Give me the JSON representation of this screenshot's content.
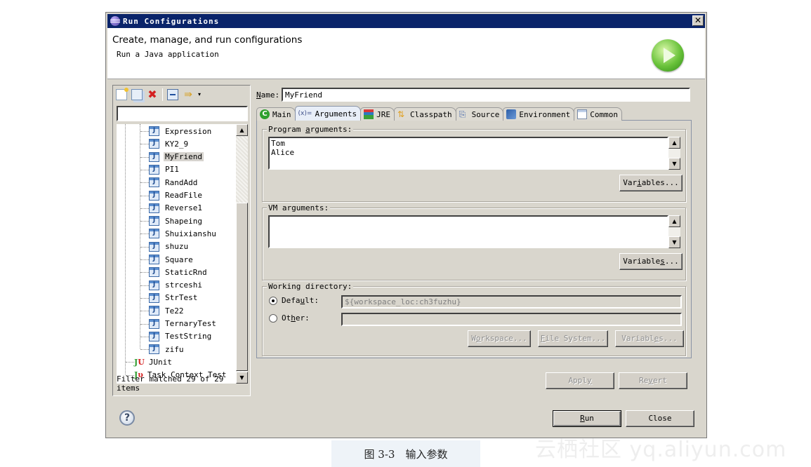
{
  "window": {
    "title": "Run Configurations",
    "close_glyph": "✕"
  },
  "header": {
    "title": "Create, manage, and run configurations",
    "subtitle": "Run a Java application",
    "icon": "run-icon"
  },
  "left": {
    "toolbar": [
      {
        "name": "new-configuration",
        "icon": "new-launch-config-icon"
      },
      {
        "name": "duplicate",
        "icon": "duplicate-icon"
      },
      {
        "name": "delete",
        "icon": "delete-icon",
        "glyph": "✖"
      },
      {
        "name": "collapse-all",
        "icon": "collapse-all-icon"
      },
      {
        "name": "filter",
        "icon": "filter-icon",
        "glyph": "⇛"
      },
      {
        "name": "view-menu",
        "icon": "dropdown-icon",
        "glyph": "▾"
      }
    ],
    "filter_value": "",
    "tree": [
      {
        "label": "Expression",
        "type": "java",
        "level": 2
      },
      {
        "label": "KY2_9",
        "type": "java",
        "level": 2
      },
      {
        "label": "MyFriend",
        "type": "java",
        "level": 2,
        "selected": true
      },
      {
        "label": "PI1",
        "type": "java",
        "level": 2
      },
      {
        "label": "RandAdd",
        "type": "java",
        "level": 2
      },
      {
        "label": "ReadFile",
        "type": "java",
        "level": 2
      },
      {
        "label": "Reverse1",
        "type": "java",
        "level": 2
      },
      {
        "label": "Shapeing",
        "type": "java",
        "level": 2
      },
      {
        "label": "Shuixianshu",
        "type": "java",
        "level": 2
      },
      {
        "label": "shuzu",
        "type": "java",
        "level": 2
      },
      {
        "label": "Square",
        "type": "java",
        "level": 2
      },
      {
        "label": "StaticRnd",
        "type": "java",
        "level": 2
      },
      {
        "label": "strceshi",
        "type": "java",
        "level": 2
      },
      {
        "label": "StrTest",
        "type": "java",
        "level": 2
      },
      {
        "label": "Te22",
        "type": "java",
        "level": 2
      },
      {
        "label": "TernaryTest",
        "type": "java",
        "level": 2
      },
      {
        "label": "TestString",
        "type": "java",
        "level": 2
      },
      {
        "label": "zifu",
        "type": "java",
        "level": 2
      },
      {
        "label": "JUnit",
        "type": "junit",
        "level": 1
      },
      {
        "label": "Task Context Test",
        "type": "junit-task",
        "level": 1
      }
    ],
    "status": "Filter matched 29 of 29 items"
  },
  "config": {
    "name_label": "Name:",
    "name_value": "MyFriend",
    "tabs": [
      {
        "label": "Main",
        "icon": "main-tab-icon",
        "glyph": "C"
      },
      {
        "label": "Arguments",
        "icon": "arguments-tab-icon",
        "glyph": "(x)=",
        "active": true
      },
      {
        "label": "JRE",
        "icon": "jre-tab-icon"
      },
      {
        "label": "Classpath",
        "icon": "classpath-tab-icon",
        "glyph": "⇅"
      },
      {
        "label": "Source",
        "icon": "source-tab-icon",
        "glyph": "⎘"
      },
      {
        "label": "Environment",
        "icon": "environment-tab-icon"
      },
      {
        "label": "Common",
        "icon": "common-tab-icon"
      }
    ],
    "program_args": {
      "label": "Program arguments:",
      "value": "Tom\nAlice",
      "variables_button": "Variables..."
    },
    "vm_args": {
      "label": "VM arguments:",
      "value": "",
      "variables_button": "Variables..."
    },
    "working_dir": {
      "label": "Working directory:",
      "default_label": "Default:",
      "default_value": "${workspace_loc:ch3fuzhu}",
      "default_checked": true,
      "other_label": "Other:",
      "other_value": "",
      "buttons": [
        "Workspace...",
        "File System...",
        "Variables..."
      ]
    },
    "apply_button": "Apply",
    "revert_button": "Revert"
  },
  "footer": {
    "run_button": "Run",
    "close_button": "Close",
    "help_glyph": "?"
  },
  "caption": "图 3-3　输入参数",
  "watermark": "云栖社区 yq.aliyun.com"
}
